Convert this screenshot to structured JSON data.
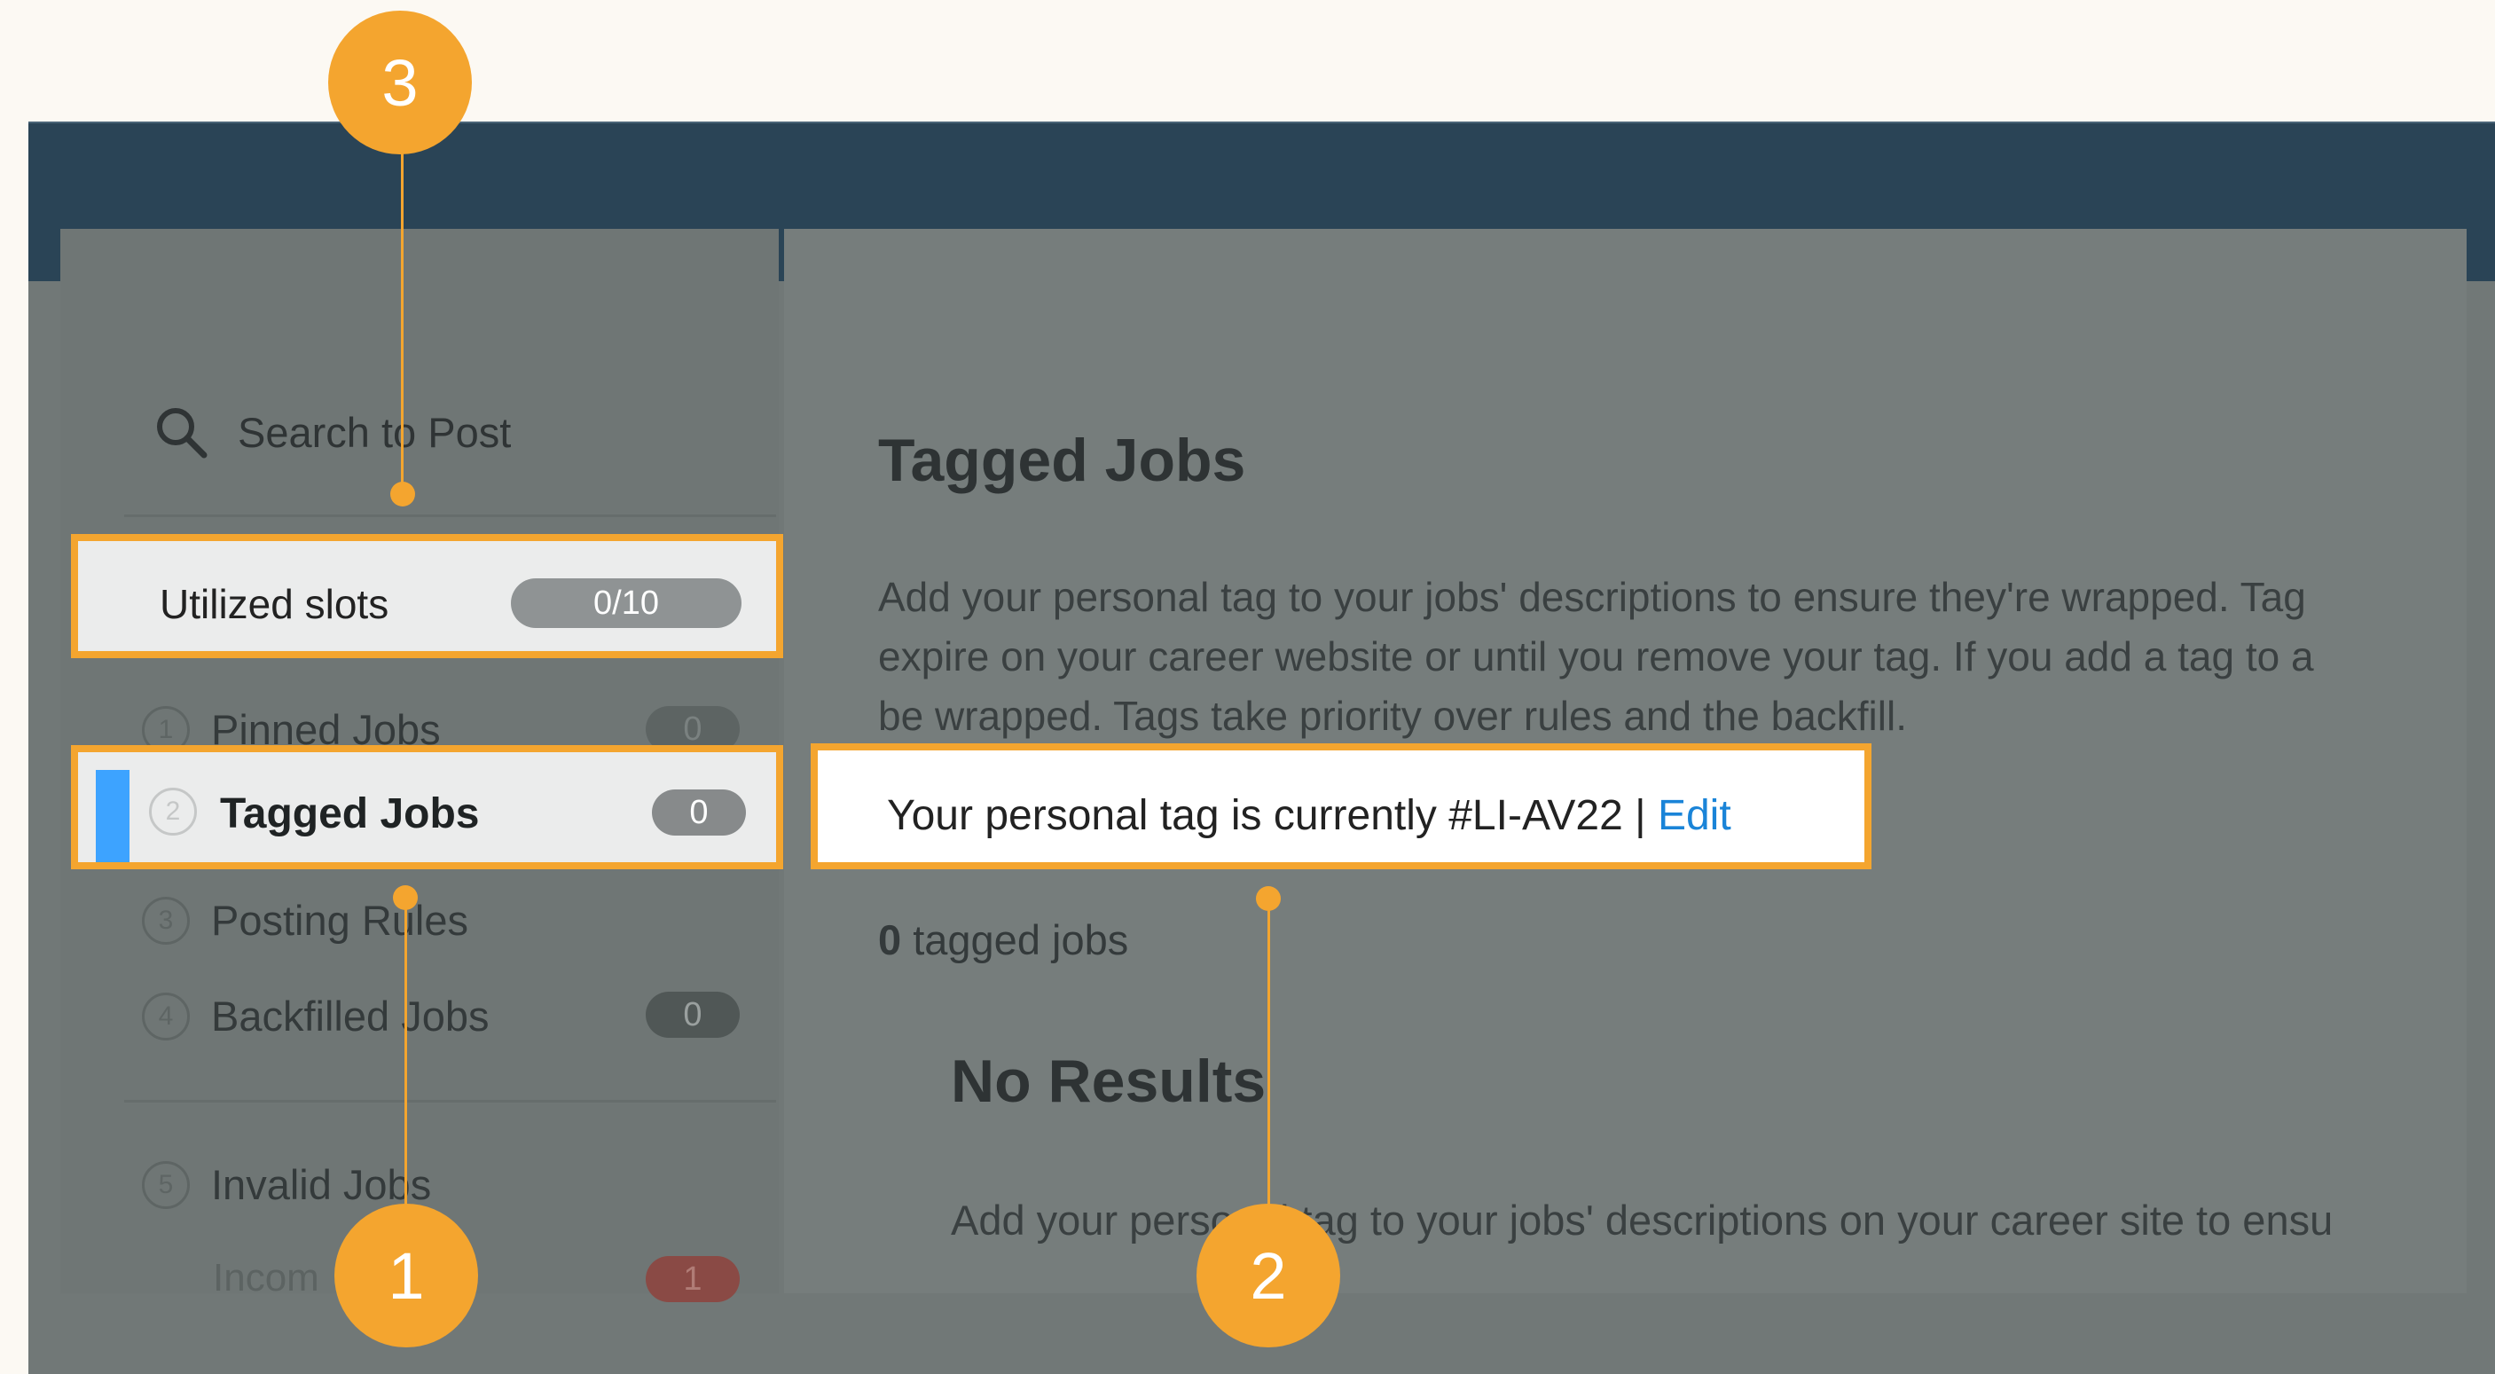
{
  "sidebar": {
    "search": {
      "label": "Search to Post"
    },
    "utilized_slots": {
      "label": "Utilized slots",
      "value": "0/10"
    },
    "items": [
      {
        "number": "1",
        "label": "Pinned Jobs",
        "count": "0"
      },
      {
        "number": "2",
        "label": "Tagged Jobs",
        "count": "0"
      },
      {
        "number": "3",
        "label": "Posting Rules"
      },
      {
        "number": "4",
        "label": "Backfilled Jobs",
        "count": "0"
      },
      {
        "number": "5",
        "label": "Invalid Jobs"
      }
    ],
    "incomplete": {
      "label": "Incom",
      "count": "1"
    }
  },
  "main": {
    "title": "Tagged Jobs",
    "description_lines": [
      "Add your personal tag to your jobs' descriptions to ensure they're wrapped. Tag",
      "expire on your career website or until you remove your tag. If you add a tag to a",
      "be wrapped. Tags take priority over rules and the backfill."
    ],
    "personal_tag": {
      "text": "Your personal tag is currently #LI-AV22 | ",
      "edit_label": "Edit"
    },
    "tagged_count": {
      "number": "0",
      "label": " tagged jobs"
    },
    "no_results": {
      "title": "No Results",
      "text": "Add your personal tag to your jobs' descriptions on your career site to ensu"
    }
  },
  "annotations": [
    {
      "number": "1"
    },
    {
      "number": "2"
    },
    {
      "number": "3"
    }
  ],
  "colors": {
    "annotation": "#f4a52f",
    "header": "#2a4456",
    "overlay": "#717877",
    "active_indicator": "#3da3ff",
    "link": "#1a84d8",
    "error_badge": "#8a4a45"
  }
}
